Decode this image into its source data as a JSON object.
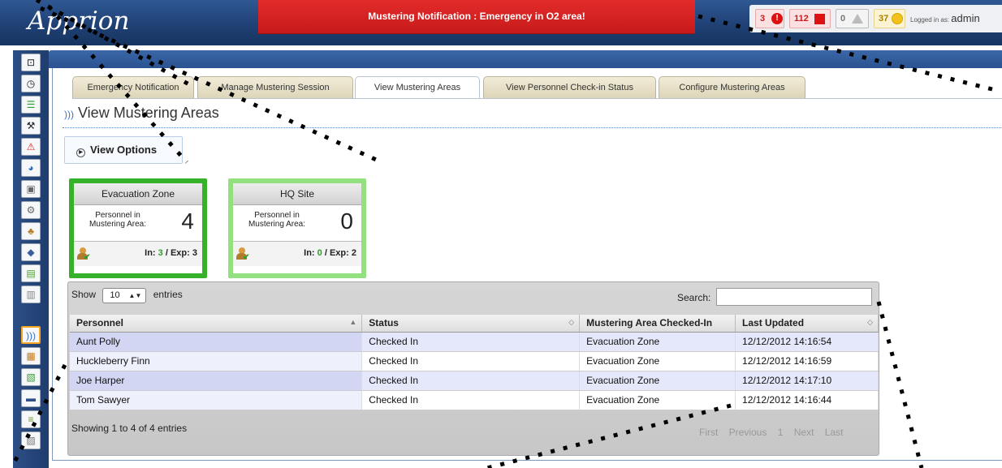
{
  "header": {
    "logo": "Apprion",
    "alert": "Mustering Notification : Emergency in O2 area!",
    "counts": {
      "critical": "3",
      "major": "112",
      "warning": "0",
      "minor": "37"
    },
    "login_prefix": "Logged in as:",
    "login_user": "admin"
  },
  "sidebar": {
    "icons": [
      "expand-icon",
      "clock-icon",
      "list-icon",
      "wrench-icon",
      "alert-icon",
      "globe-icon",
      "server-icon",
      "gear-icon",
      "users-icon",
      "diamond-icon",
      "report-icon",
      "mustering-icon",
      "reports-icon",
      "chart-icon",
      "monitor-icon",
      "database-icon",
      "device-icon"
    ]
  },
  "tabs": [
    {
      "label": "Emergency Notification"
    },
    {
      "label": "Manage Mustering Session"
    },
    {
      "label": "View Mustering Areas"
    },
    {
      "label": "View Personnel Check-in Status"
    },
    {
      "label": "Configure Mustering Areas"
    }
  ],
  "page_title": "View Mustering Areas",
  "view_options": "View Options",
  "areas": [
    {
      "name": "Evacuation Zone",
      "label": "Personnel in Mustering Area:",
      "count": "4",
      "in_label": "In:",
      "in": "3",
      "exp_label": "/ Exp:",
      "exp": "3",
      "border_color": "#35b22a"
    },
    {
      "name": "HQ Site",
      "label": "Personnel in Mustering Area:",
      "count": "0",
      "in_label": "In:",
      "in": "0",
      "exp_label": "/ Exp:",
      "exp": "2",
      "border_color": "#92e07f"
    }
  ],
  "table": {
    "show_prefix": "Show",
    "show_value": "10",
    "show_suffix": "entries",
    "search_label": "Search:",
    "search_value": "",
    "columns": [
      "Personnel",
      "Status",
      "Mustering Area Checked-In",
      "Last Updated"
    ],
    "rows": [
      [
        "Aunt Polly",
        "Checked In",
        "Evacuation Zone",
        "12/12/2012 14:16:54"
      ],
      [
        "Huckleberry Finn",
        "Checked In",
        "Evacuation Zone",
        "12/12/2012 14:16:59"
      ],
      [
        "Joe Harper",
        "Checked In",
        "Evacuation Zone",
        "12/12/2012 14:17:10"
      ],
      [
        "Tom Sawyer",
        "Checked In",
        "Evacuation Zone",
        "12/12/2012 14:16:44"
      ]
    ],
    "info": "Showing 1 to 4 of 4 entries",
    "pager": [
      "First",
      "Previous",
      "1",
      "Next",
      "Last"
    ]
  }
}
